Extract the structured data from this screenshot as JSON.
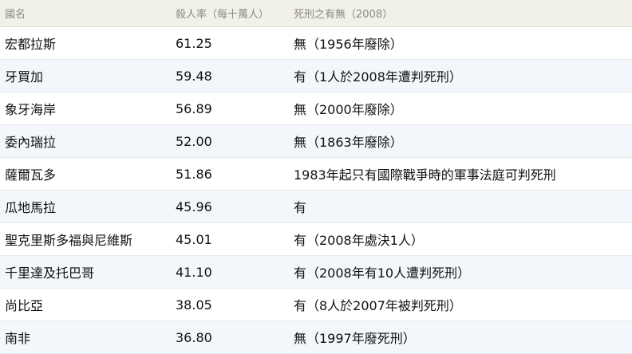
{
  "table": {
    "headers": [
      "國名",
      "殺人率（每十萬人）",
      "死刑之有無（2008）"
    ],
    "rows": [
      [
        "宏都拉斯",
        "61.25",
        "無（1956年廢除）"
      ],
      [
        "牙買加",
        "59.48",
        "有（1人於2008年遭判死刑）"
      ],
      [
        "象牙海岸",
        "56.89",
        "無（2000年廢除）"
      ],
      [
        "委內瑞拉",
        "52.00",
        "無（1863年廢除）"
      ],
      [
        "薩爾瓦多",
        "51.86",
        "1983年起只有國際戰爭時的軍事法庭可判死刑"
      ],
      [
        "瓜地馬拉",
        "45.96",
        "有"
      ],
      [
        "聖克里斯多福與尼維斯",
        "45.01",
        "有（2008年處決1人）"
      ],
      [
        "千里達及托巴哥",
        "41.10",
        "有（2008年有10人遭判死刑）"
      ],
      [
        "尚比亞",
        "38.05",
        "有（8人於2007年被判死刑）"
      ],
      [
        "南非",
        "36.80",
        "無（1997年廢死刑）"
      ]
    ]
  }
}
